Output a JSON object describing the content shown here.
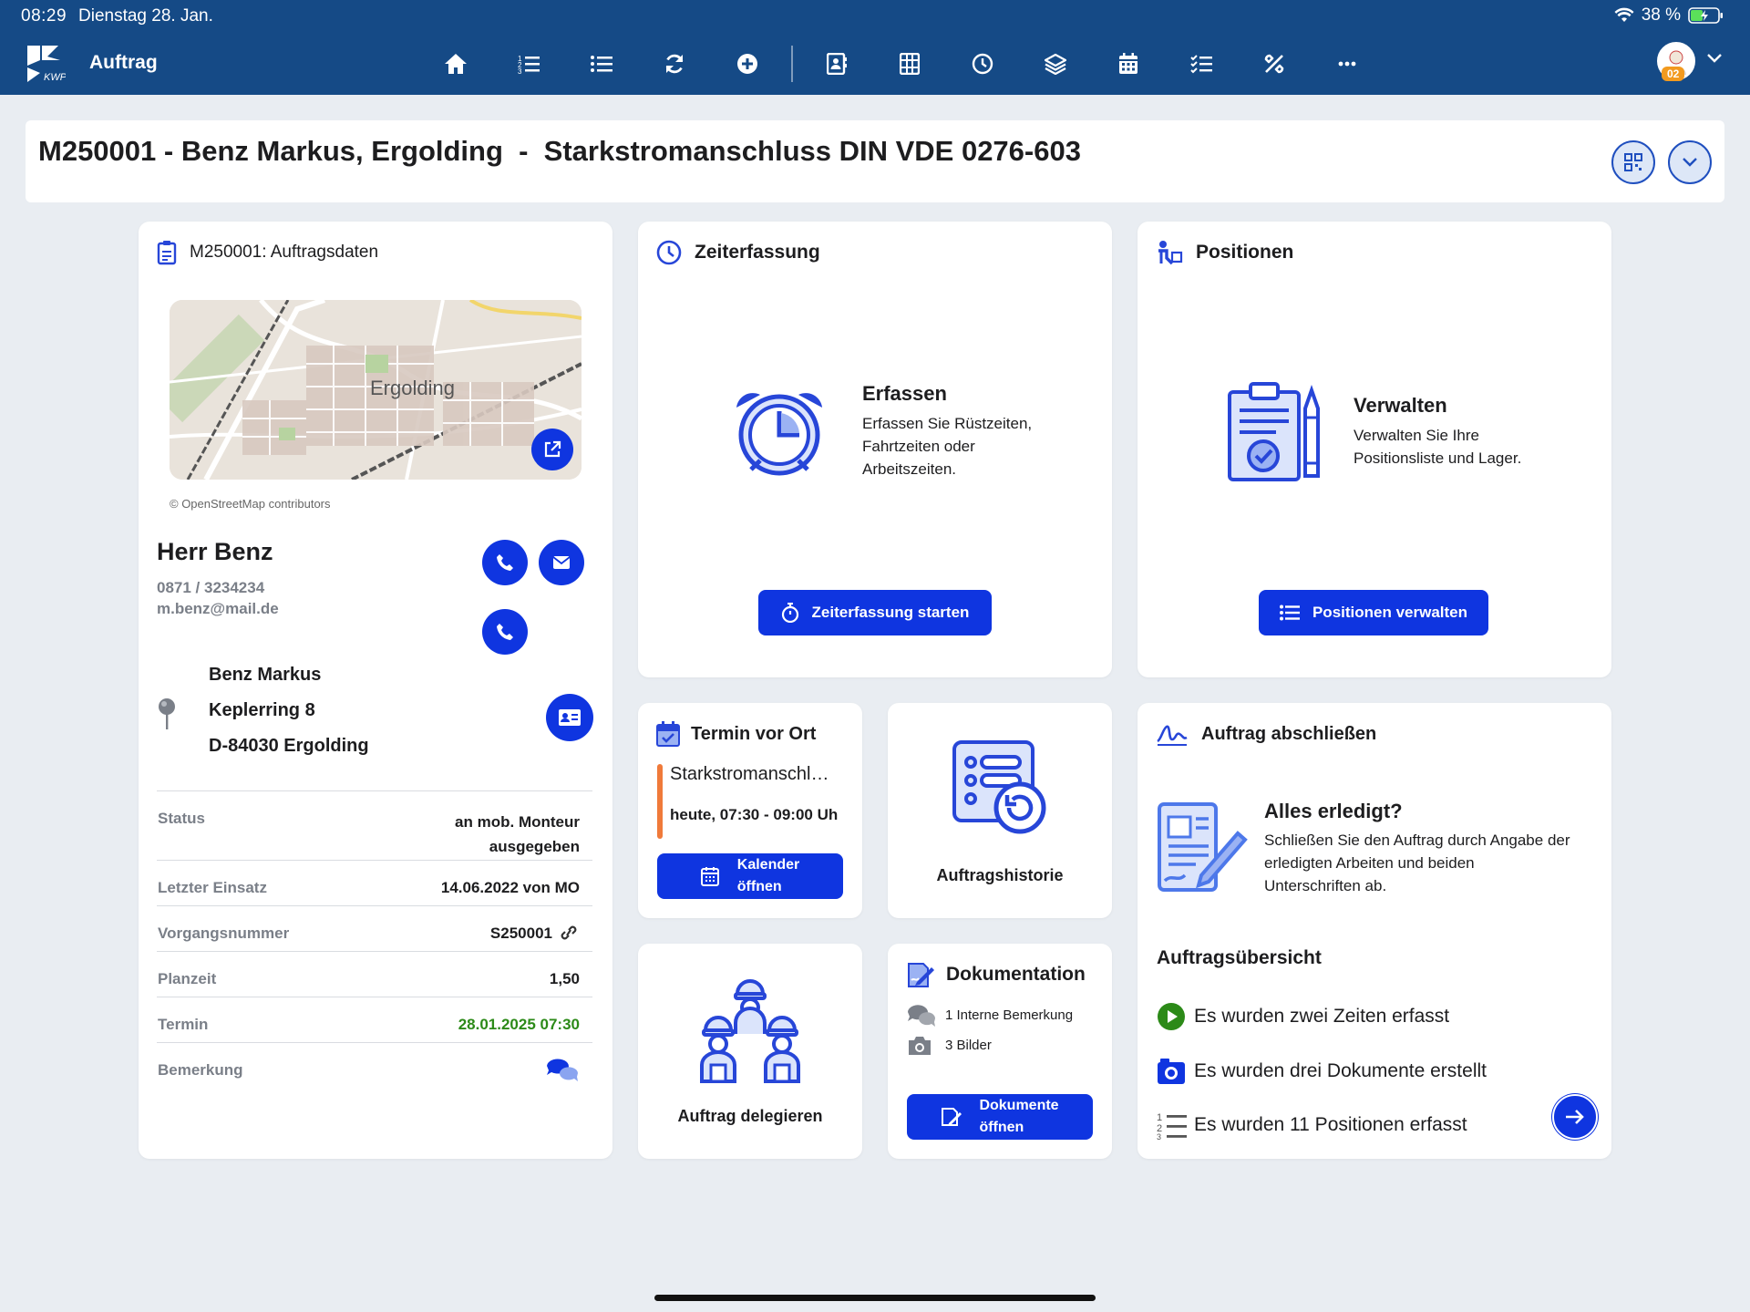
{
  "status_bar": {
    "time": "08:29",
    "date": "Dienstag 28. Jan.",
    "battery": "38 %"
  },
  "app": {
    "title": "Auftrag"
  },
  "toolbar": {
    "icons": [
      "home-icon",
      "numbered-list-icon",
      "list-icon",
      "sync-icon",
      "add-circle-icon",
      "contact-card-icon",
      "grid-icon",
      "clock-icon",
      "layers-icon",
      "calendar-icon",
      "checklist-icon",
      "tools-icon",
      "more-icon"
    ]
  },
  "user": {
    "badge": "02"
  },
  "header": {
    "title": "M250001 - Benz Markus, Ergolding  -  Starkstromanschluss DIN VDE 0276-603"
  },
  "order": {
    "card_title": "M250001: Auftragsdaten",
    "map_label": "Ergolding",
    "map_credit": "© OpenStreetMap contributors",
    "contact_name": "Herr Benz",
    "phone": "0871 / 3234234",
    "email": "m.benz@mail.de",
    "address": [
      "Benz Markus",
      "Keplerring 8",
      "D-84030 Ergolding"
    ],
    "details": [
      {
        "label": "Status",
        "value": "an mob. Monteur\nausgegeben"
      },
      {
        "label": "Letzter Einsatz",
        "value": "14.06.2022 von MO"
      },
      {
        "label": "Vorgangsnummer",
        "value": "S250001"
      },
      {
        "label": "Planzeit",
        "value": "1,50"
      },
      {
        "label": "Termin",
        "value": "28.01.2025 07:30"
      },
      {
        "label": "Bemerkung",
        "value": ""
      }
    ]
  },
  "time": {
    "title": "Zeiterfassung",
    "heading": "Erfassen",
    "text": "Erfassen Sie Rüstzeiten,\nFahrtzeiten oder\nArbeitszeiten.",
    "button": "Zeiterfassung starten"
  },
  "positions": {
    "title": "Positionen",
    "heading": "Verwalten",
    "text": "Verwalten Sie Ihre\nPositionsliste und Lager.",
    "button": "Positionen verwalten"
  },
  "appointment": {
    "title": "Termin vor Ort",
    "subject": "Starkstromanschl…",
    "time": "heute, 07:30 - 09:00 Uh",
    "button": "Kalender\nöffnen"
  },
  "history": {
    "label": "Auftragshistorie"
  },
  "delegate": {
    "label": "Auftrag delegieren"
  },
  "docs": {
    "title": "Dokumentation",
    "remarks": "1 Interne Bemerkung",
    "images": "3 Bilder",
    "button": "Dokumente\nöffnen"
  },
  "finish": {
    "title": "Auftrag abschließen",
    "heading": "Alles erledigt?",
    "text": "Schließen Sie den Auftrag durch Angabe der\nerledigten Arbeiten und beiden\nUnterschriften ab.",
    "overview_title": "Auftragsübersicht",
    "items": [
      "Es wurden zwei Zeiten erfasst",
      "Es wurden drei Dokumente erstellt",
      "Es wurden 11 Positionen erfasst"
    ]
  },
  "colors": {
    "topbar": "#154a86",
    "accent": "#0f35e0",
    "icon_blue": "#2746d8",
    "green": "#2c8a18",
    "orange": "#f07a3a"
  }
}
